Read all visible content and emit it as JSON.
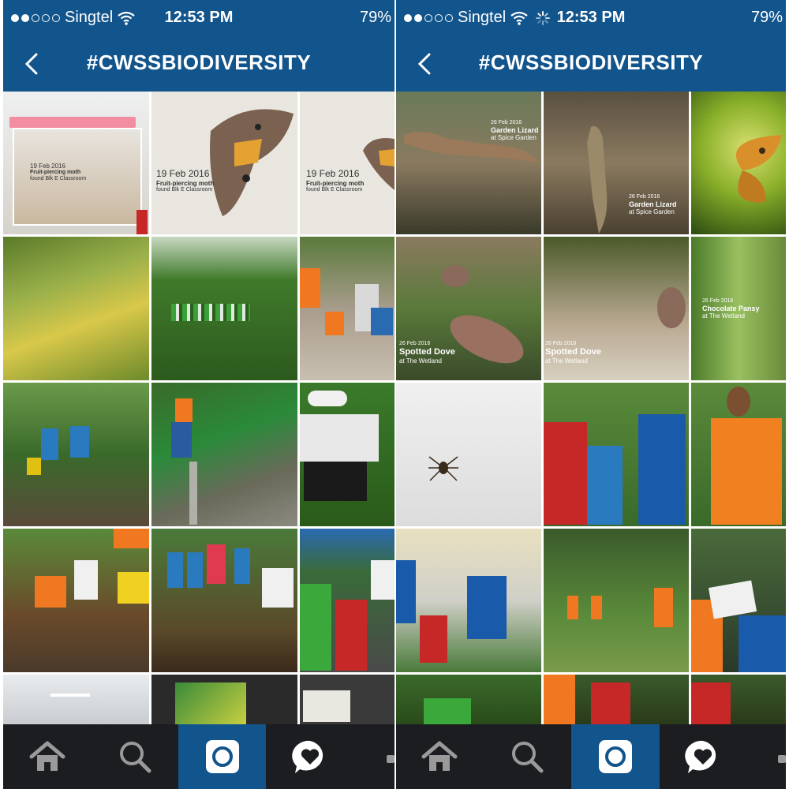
{
  "left_screen": {
    "status": {
      "carrier": "Singtel",
      "time": "12:53 PM",
      "battery": "79"
    },
    "header": {
      "title": "#CWSSBIODIVERSITY"
    },
    "captions": [
      {
        "date": "19 Feb 2016",
        "name": "Fruit-piercing moth",
        "place": "found Blk E Classroom"
      },
      {
        "date": "19 Feb 2016",
        "name": "Fruit-piercing moth",
        "place": "found Blk E Classroom"
      },
      {
        "date": "19 Feb 2016",
        "name": "Fruit-piercing moth",
        "place": "found Blk E Classroom"
      }
    ],
    "tabs": [
      "home-icon",
      "search-icon",
      "camera-icon",
      "activity-icon",
      "profile-icon"
    ]
  },
  "right_screen": {
    "status": {
      "carrier": "Singtel",
      "time": "12:53 PM",
      "battery": "79"
    },
    "header": {
      "title": "#CWSSBIODIVERSITY"
    },
    "captions": [
      {
        "date": "26 Feb 2016",
        "name": "Garden Lizard",
        "place": "at Spice Garden"
      },
      {
        "date": "26 Feb 2016",
        "name": "Garden Lizard",
        "place": "at Spice Garden"
      },
      {
        "date": "26 Feb 2016",
        "name": "Spotted Dove",
        "place": "at The Wetland"
      },
      {
        "date": "26 Feb 2016",
        "name": "Spotted Dove",
        "place": "at The Wetland"
      },
      {
        "date": "26 Feb 2016",
        "name": "Chocolate Pansy",
        "place": "at The Wetland"
      }
    ],
    "tabs": [
      "home-icon",
      "search-icon",
      "camera-icon",
      "activity-icon",
      "profile-icon"
    ]
  },
  "colors": {
    "header_blue": "#12548c",
    "tabbar": "#1b1d20",
    "active_tab": "#12548c"
  }
}
